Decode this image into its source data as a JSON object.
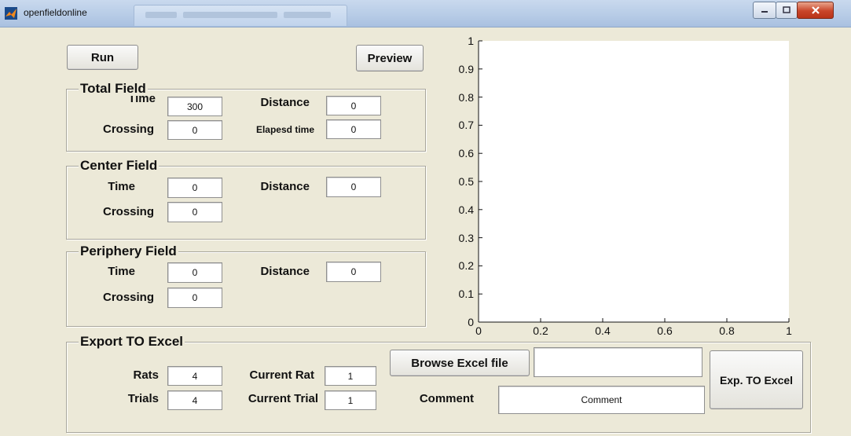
{
  "window": {
    "title": "openfieldonline",
    "controls": [
      "minimize",
      "maximize",
      "close"
    ]
  },
  "buttons": {
    "run": "Run",
    "preview": "Preview",
    "browse": "Browse Excel file",
    "export": "Exp. TO Excel"
  },
  "total_field": {
    "title": "Total Field",
    "time_label": "Time",
    "time_value": "300",
    "distance_label": "Distance",
    "distance_value": "0",
    "crossing_label": "Crossing",
    "crossing_value": "0",
    "elapsed_label": "Elapesd time",
    "elapsed_value": "0"
  },
  "center_field": {
    "title": "Center Field",
    "time_label": "Time",
    "time_value": "0",
    "distance_label": "Distance",
    "distance_value": "0",
    "crossing_label": "Crossing",
    "crossing_value": "0"
  },
  "periphery_field": {
    "title": "Periphery Field",
    "time_label": "Time",
    "time_value": "0",
    "distance_label": "Distance",
    "distance_value": "0",
    "crossing_label": "Crossing",
    "crossing_value": "0"
  },
  "export_panel": {
    "title": "Export TO Excel",
    "rats_label": "Rats",
    "rats_value": "4",
    "trials_label": "Trials",
    "trials_value": "4",
    "current_rat_label": "Current Rat",
    "current_rat_value": "1",
    "current_trial_label": "Current Trial",
    "current_trial_value": "1",
    "comment_label": "Comment",
    "comment_value": "Comment",
    "file_path": ""
  },
  "chart_data": {
    "type": "scatter",
    "x": [],
    "y": [],
    "xlim": [
      0,
      1
    ],
    "ylim": [
      0,
      1
    ],
    "x_ticks": [
      "0",
      "0.2",
      "0.4",
      "0.6",
      "0.8",
      "1"
    ],
    "y_ticks": [
      "0",
      "0.1",
      "0.2",
      "0.3",
      "0.4",
      "0.5",
      "0.6",
      "0.7",
      "0.8",
      "0.9",
      "1"
    ],
    "grid": false
  }
}
